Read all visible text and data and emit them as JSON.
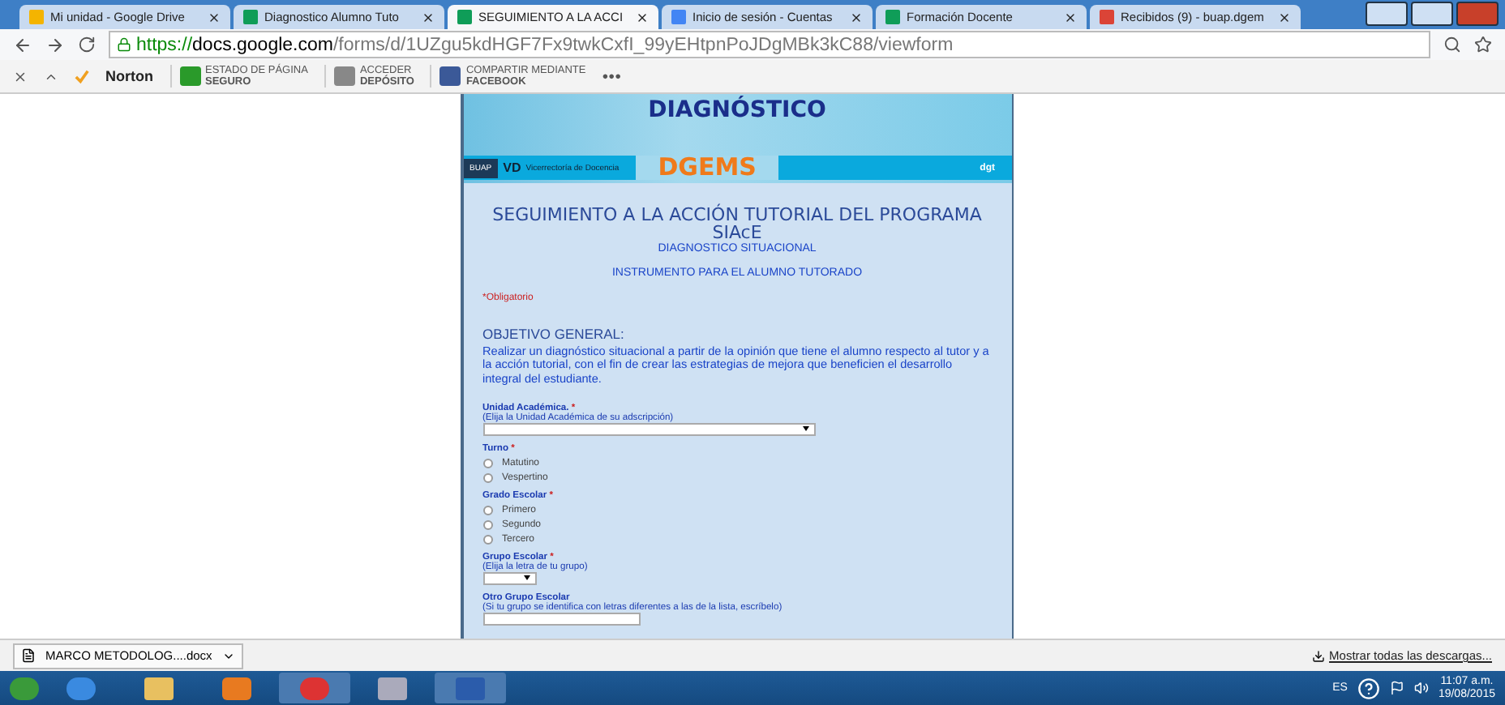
{
  "tabs": [
    {
      "title": "Mi unidad - Google Drive",
      "kind": "drive",
      "selected": false
    },
    {
      "title": "Diagnostico Alumno Tuto",
      "kind": "forms",
      "selected": false
    },
    {
      "title": "SEGUIMIENTO A LA ACCI",
      "kind": "forms",
      "selected": true
    },
    {
      "title": "Inicio de sesión - Cuentas",
      "kind": "account",
      "selected": false
    },
    {
      "title": "Formación Docente",
      "kind": "forms",
      "selected": false
    },
    {
      "title": "Recibidos (9) - buap.dgem",
      "kind": "mail",
      "selected": false
    }
  ],
  "address": {
    "scheme": "https://",
    "host": "docs.google.com",
    "path": "/forms/d/1UZgu5kdHGF7Fx9twkCxfI_99yEHtpnPoJDgMBk3kC88/viewform"
  },
  "norton": {
    "brand": "Norton",
    "items": [
      {
        "top": "ESTADO DE PÁGINA",
        "bottom": "SEGURO",
        "kind": "check"
      },
      {
        "top": "ACCEDER",
        "bottom": "DEPÓSITO",
        "kind": "vault"
      },
      {
        "top": "COMPARTIR MEDIANTE",
        "bottom": "FACEBOOK",
        "kind": "facebook"
      }
    ],
    "more": "●●●"
  },
  "banner": {
    "title": "DIAGNÓSTICO",
    "org": "DGEMS",
    "left_logo": "BUAP",
    "vd": "VD",
    "vd_text": "Vicerrectoría de Docencia",
    "right_logo": "dgt"
  },
  "form": {
    "title": "SEGUIMIENTO A LA ACCIÓN TUTORIAL DEL PROGRAMA SIAcE",
    "subtitle": "DIAGNOSTICO SITUACIONAL",
    "subtitle2": "INSTRUMENTO PARA EL ALUMNO TUTORADO",
    "required_note": "*Obligatorio",
    "required_mark": "*",
    "section": "OBJETIVO GENERAL:",
    "description": "Realizar un diagnóstico situacional a partir de la opinión que tiene el alumno respecto al tutor y a la acción tutorial, con el fin de crear las estrategias de mejora que beneficien el desarrollo integral del estudiante.",
    "questions": [
      {
        "kind": "select",
        "label": "Unidad Académica.",
        "required": true,
        "help": "(Elija la Unidad Académica de su adscripción)",
        "wide": true
      },
      {
        "kind": "radio",
        "label": "Turno",
        "required": true,
        "options": [
          {
            "label": "Matutino",
            "selected": false
          },
          {
            "label": "Vespertino",
            "selected": false
          }
        ]
      },
      {
        "kind": "radio",
        "label": "Grado Escolar",
        "required": true,
        "options": [
          {
            "label": "Primero",
            "selected": false
          },
          {
            "label": "Segundo",
            "selected": false
          },
          {
            "label": "Tercero",
            "selected": false
          }
        ]
      },
      {
        "kind": "select",
        "label": "Grupo Escolar",
        "required": true,
        "help": "(Elija la letra de tu grupo)",
        "wide": false
      },
      {
        "kind": "text",
        "label": "Otro Grupo Escolar",
        "required": false,
        "help": "(Si tu grupo se identifica con letras diferentes a las de la lista, escríbelo)"
      }
    ]
  },
  "download": {
    "file": "MARCO METODOLOG....docx",
    "show_all": "Mostrar todas las descargas..."
  },
  "taskbar": {
    "lang": "ES",
    "time": "11:07 a.m.",
    "date": "19/08/2015"
  }
}
